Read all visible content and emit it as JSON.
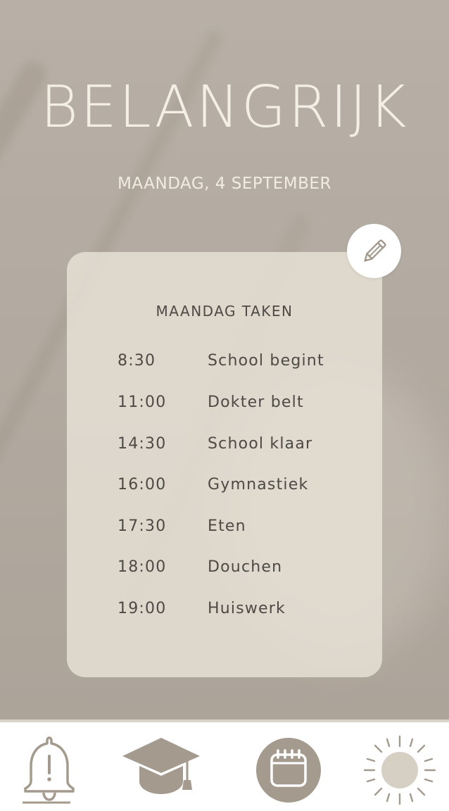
{
  "header": {
    "title": "BELANGRIJK",
    "date": "MAANDAG, 4 SEPTEMBER"
  },
  "card": {
    "title": "MAANDAG TAKEN",
    "tasks": [
      {
        "time": "8:30",
        "label": "School begint"
      },
      {
        "time": "11:00",
        "label": "Dokter belt"
      },
      {
        "time": "14:30",
        "label": "School klaar"
      },
      {
        "time": "16:00",
        "label": "Gymnastiek"
      },
      {
        "time": "17:30",
        "label": "Eten"
      },
      {
        "time": "18:00",
        "label": "Douchen"
      },
      {
        "time": "19:00",
        "label": "Huiswerk"
      }
    ]
  },
  "icons": {
    "edit": "pencil-icon",
    "nav": [
      "bell-alert-icon",
      "graduation-cap-icon",
      "calendar-icon",
      "sun-icon"
    ]
  },
  "colors": {
    "background": "#b3aba1",
    "card": "#e8e2d7",
    "text_light": "#f4efe6",
    "text_dark": "#4d4a46",
    "icon": "#a49a8e"
  }
}
